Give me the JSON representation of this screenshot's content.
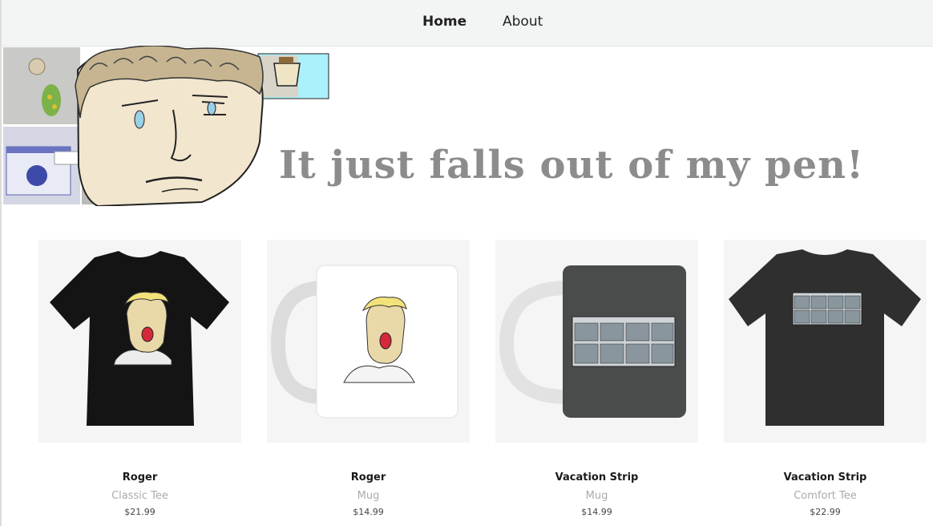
{
  "nav": {
    "home_label": "Home",
    "about_label": "About"
  },
  "hero": {
    "tagline": "It just falls out of my pen!"
  },
  "products": [
    {
      "name": "Roger",
      "type": "Classic Tee",
      "price": "$21.99"
    },
    {
      "name": "Roger",
      "type": "Mug",
      "price": "$14.99"
    },
    {
      "name": "Vacation Strip",
      "type": "Mug",
      "price": "$14.99"
    },
    {
      "name": "Vacation Strip",
      "type": "Comfort Tee",
      "price": "$22.99"
    }
  ]
}
